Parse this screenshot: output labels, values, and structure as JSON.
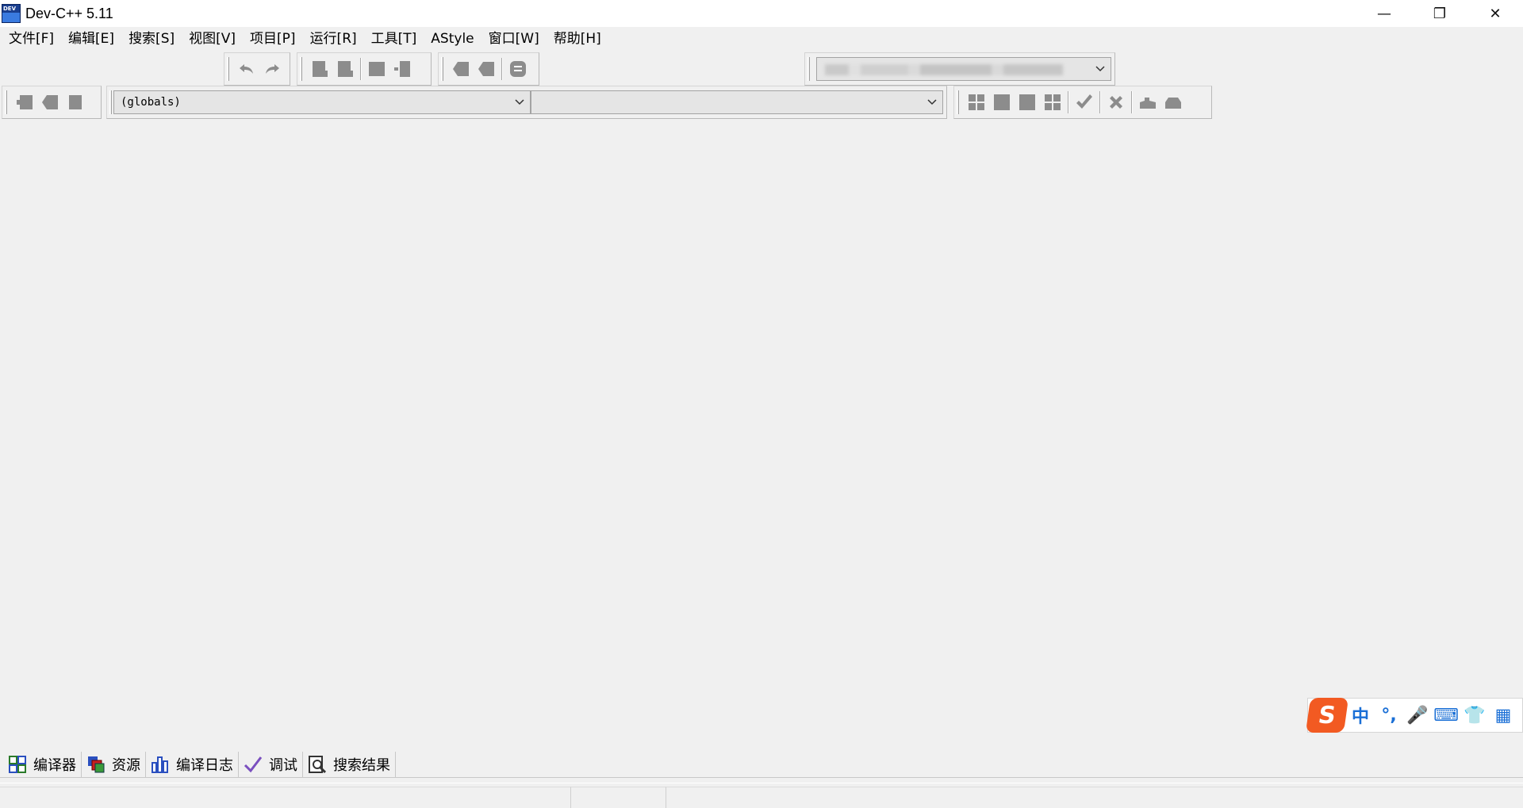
{
  "window": {
    "title": "Dev-C++ 5.11",
    "controls": {
      "minimize": "—",
      "maximize": "❐",
      "close": "✕"
    }
  },
  "menu": [
    {
      "label": "文件[F]"
    },
    {
      "label": "编辑[E]"
    },
    {
      "label": "搜索[S]"
    },
    {
      "label": "视图[V]"
    },
    {
      "label": "项目[P]"
    },
    {
      "label": "运行[R]"
    },
    {
      "label": "工具[T]"
    },
    {
      "label": "AStyle"
    },
    {
      "label": "窗口[W]"
    },
    {
      "label": "帮助[H]"
    }
  ],
  "toolbar": {
    "class_combo_value": "(globals)",
    "member_combo_value": "",
    "compiler_combo_value": ""
  },
  "ime": {
    "logo": "S",
    "mode": "中",
    "punct": "°,",
    "mic": "🎤",
    "keyboard": "⌨",
    "skin": "👕",
    "toolbox": "▦"
  },
  "bottom_tabs": [
    {
      "label": "编译器",
      "icon": "compiler-grid-icon"
    },
    {
      "label": "资源",
      "icon": "resources-icon"
    },
    {
      "label": "编译日志",
      "icon": "compile-log-chart-icon"
    },
    {
      "label": "调试",
      "icon": "debug-check-icon"
    },
    {
      "label": "搜索结果",
      "icon": "search-results-icon"
    }
  ],
  "colors": {
    "ime_accent": "#1a6fd6",
    "ime_logo": "#f25a22",
    "toolbar_icon": "#8c8c8c"
  }
}
